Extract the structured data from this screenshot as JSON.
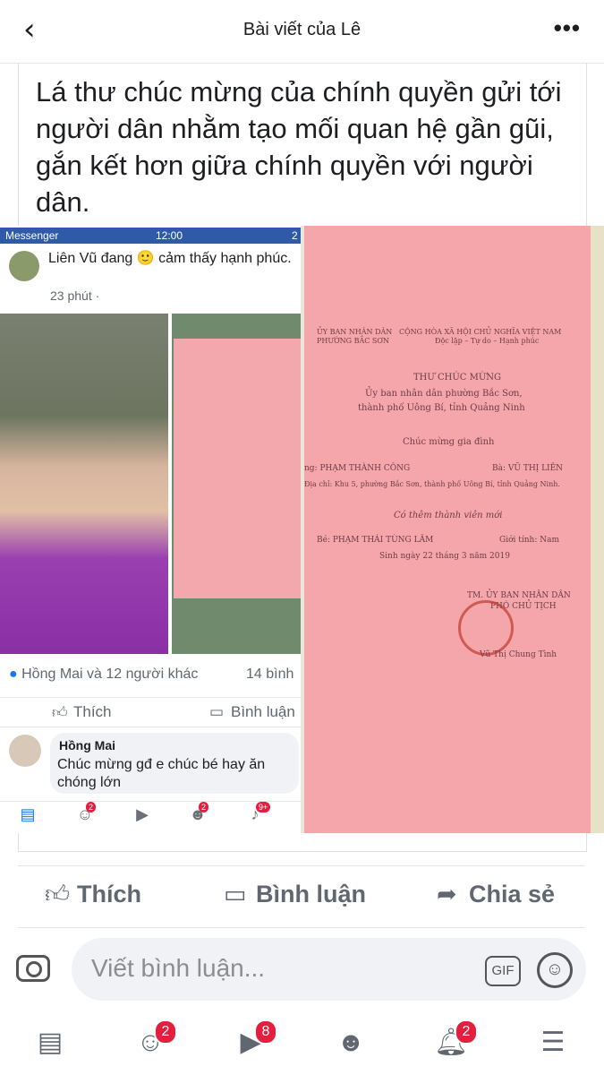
{
  "header": {
    "title": "Bài viết của Lê",
    "back_icon": "back-icon",
    "more_icon": "more-icon"
  },
  "post": {
    "text": "Lá thư chúc mừng của chính quyền gửi tới người dân nhằm tạo mối quan hệ gần gũi, gắn kết hơn giữa chính quyền với người dân."
  },
  "screenshot": {
    "status": {
      "app": "Messenger",
      "time": "12:00",
      "right": "2"
    },
    "author": "Liên Vũ đang 🙂 cảm thấy hạnh phúc.",
    "time": "23 phút ·",
    "reactions": "Hồng Mai và 12 người khác",
    "comments_count": "14 bình",
    "like": "Thích",
    "comment": "Bình luận",
    "commenter": "Hồng Mai",
    "comment_text": "Chúc mừng gđ e chúc bé hay ăn chóng lớn",
    "tab_badges": {
      "friends": "2",
      "groups": "2",
      "notifications": "9+"
    }
  },
  "document": {
    "header_left1": "ỦY BAN NHÂN DÂN",
    "header_left2": "PHƯỜNG BẮC SƠN",
    "header_right1": "CỘNG HÒA XÃ HỘI CHỦ NGHĨA VIỆT NAM",
    "header_right2": "Độc lập – Tự do – Hạnh phúc",
    "title": "THƯ CHÚC MỪNG",
    "org1": "Ủy ban nhân dân phường Bắc Sơn,",
    "org2": "thành phố Uông Bí, tỉnh Quảng Ninh",
    "greeting": "Chúc mừng gia đình",
    "parent1": "ng: PHẠM THÀNH CÔNG",
    "parent2": "Bà: VŨ THỊ LIÊN",
    "address": "Địa chỉ: Khu 5, phường Bắc Sơn, thành phố Uông Bí, tỉnh Quảng Ninh.",
    "new_member": "Có thêm thành viên mới",
    "baby": "Bé: PHẠM THÁI TÙNG LÂM",
    "gender": "Giới tính: Nam",
    "birth": "Sinh ngày 22 tháng 3 năm 2019",
    "sign1": "TM. ỦY BAN NHÂN DÂN",
    "sign2": "PHÓ CHỦ TỊCH",
    "signer": "Vũ Thị Chung Tình"
  },
  "actions": {
    "like": "Thích",
    "comment": "Bình luận",
    "share": "Chia sẻ"
  },
  "comment_input": {
    "placeholder": "Viết bình luận...",
    "gif": "GIF"
  },
  "tabbar": {
    "friends_badge": "2",
    "watch_badge": "8",
    "notifications_badge": "2"
  },
  "colors": {
    "badge": "#e41e3f",
    "accent": "#1877f2",
    "paper": "#f5a6ab"
  }
}
